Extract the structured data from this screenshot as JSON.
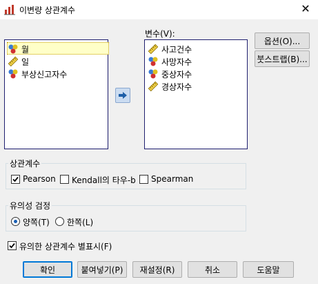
{
  "window": {
    "title": "이변량 상관계수",
    "close_glyph": "✕"
  },
  "source_list": [
    {
      "label": "월",
      "icon": "nominal-icon"
    },
    {
      "label": "일",
      "icon": "scale-icon"
    },
    {
      "label": "부상신고자수",
      "icon": "nominal-icon"
    }
  ],
  "variables": {
    "label": "변수(V):",
    "items": [
      {
        "label": "사고건수",
        "icon": "scale-icon"
      },
      {
        "label": "사망자수",
        "icon": "nominal-icon"
      },
      {
        "label": "중상자수",
        "icon": "nominal-icon"
      },
      {
        "label": "경상자수",
        "icon": "scale-icon"
      }
    ]
  },
  "side_buttons": {
    "options": "옵션(O)...",
    "bootstrap": "붓스트랩(B)..."
  },
  "correlation": {
    "title": "상관계수",
    "pearson": "Pearson",
    "pearson_checked": true,
    "kendall": "Kendall의 타우-b",
    "kendall_checked": false,
    "spearman": "Spearman",
    "spearman_checked": false
  },
  "significance": {
    "title": "유의성 검정",
    "two_tailed": "양쪽(T)",
    "one_tailed": "한쪽(L)",
    "selected": "two_tailed"
  },
  "flag": {
    "label": "유의한 상관계수 별표시(F)",
    "checked": true
  },
  "bottom_buttons": {
    "ok": "확인",
    "paste": "붙여넣기(P)",
    "reset": "재설정(R)",
    "cancel": "취소",
    "help": "도움말"
  },
  "colors": {
    "accent": "#0078d7",
    "selection": "#ffffc8",
    "list_border": "#1e1e6e"
  }
}
